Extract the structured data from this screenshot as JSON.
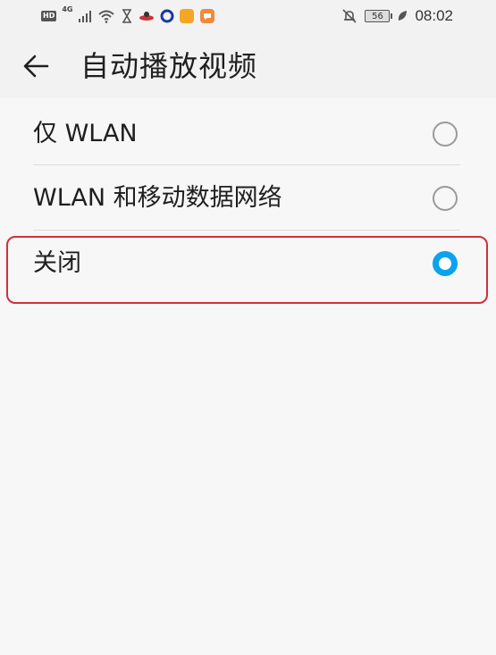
{
  "status_bar": {
    "hd_label": "HD",
    "network_label": "4G",
    "battery_level": "56",
    "time": "08:02",
    "icons_left": [
      "hd-badge",
      "signal-icon",
      "wifi-icon",
      "hourglass-icon",
      "app-icon",
      "circle-app-icon",
      "orange-app-icon",
      "chat-app-icon"
    ],
    "icons_right": [
      "mute-bell-icon",
      "battery-icon",
      "leaf-icon"
    ]
  },
  "header": {
    "back_icon": "arrow-left-icon",
    "title": "自动播放视频"
  },
  "options": [
    {
      "label": "仅 WLAN",
      "selected": false
    },
    {
      "label": "WLAN 和移动数据网络",
      "selected": false
    },
    {
      "label": "关闭",
      "selected": true
    }
  ],
  "colors": {
    "accent": "#0aa3ee",
    "highlight_border": "#d0303a",
    "background": "#f7f7f7",
    "divider": "#dcdcdc"
  }
}
